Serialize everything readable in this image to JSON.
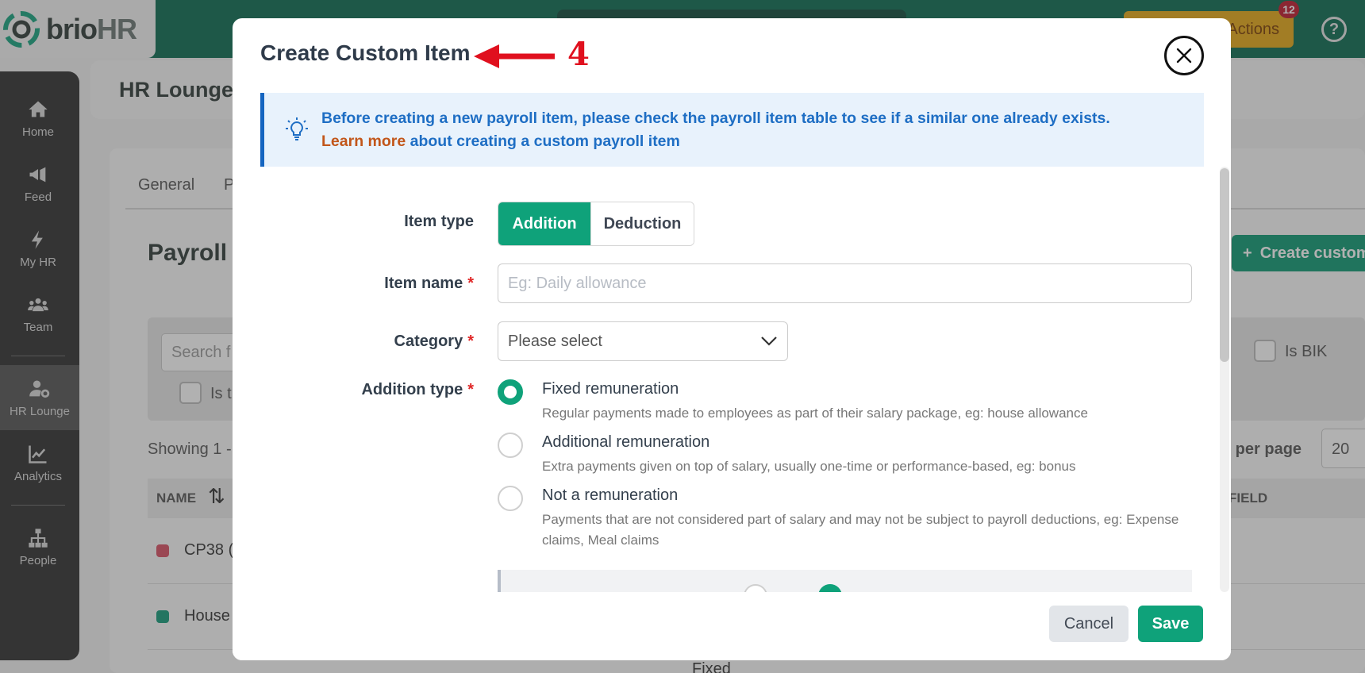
{
  "app": {
    "logo_main": "brio",
    "logo_suffix": "HR"
  },
  "topbar": {
    "actions_label": "Actions",
    "notification_count": "12",
    "help_label": "?"
  },
  "sidebar": {
    "items": [
      {
        "label": "Home",
        "icon": "home-icon"
      },
      {
        "label": "Feed",
        "icon": "megaphone-icon"
      },
      {
        "label": "My HR",
        "icon": "bolt-icon"
      },
      {
        "label": "Team",
        "icon": "team-icon"
      },
      {
        "label": "HR Lounge",
        "icon": "user-gear-icon",
        "active": true
      },
      {
        "label": "Analytics",
        "icon": "chart-line-icon"
      },
      {
        "label": "People",
        "icon": "org-chart-icon"
      }
    ]
  },
  "background": {
    "page_title": "HR Lounge",
    "tabs": [
      "General",
      "P"
    ],
    "section_title": "Payroll I",
    "create_button": "Create custom",
    "search_placeholder": "Search f",
    "is_bik_label": "Is BIK",
    "is_t_label": "Is t",
    "showing_text": "Showing 1 -",
    "per_page_label": "s per page",
    "per_page_value": "20",
    "table_headers": {
      "name": "NAME",
      "field": "FIELD"
    },
    "rows": [
      {
        "name": "CP38 (",
        "color": "#d94f63"
      },
      {
        "name": "House",
        "color": "#159c7a"
      }
    ],
    "fixed_text": "Fixed"
  },
  "modal": {
    "title": "Create Custom Item",
    "annotation_number": "4",
    "info": {
      "text_before": "Before creating a new payroll item, please check the payroll item table to see if a similar one already exists.",
      "link_text": "Learn more",
      "text_after": "about creating a custom payroll item"
    },
    "item_type": {
      "label": "Item type",
      "options": [
        "Addition",
        "Deduction"
      ],
      "selected": "Addition"
    },
    "item_name": {
      "label": "Item name",
      "placeholder": "Eg: Daily allowance",
      "value": ""
    },
    "category": {
      "label": "Category",
      "value": "Please select"
    },
    "addition_type": {
      "label": "Addition type",
      "options": [
        {
          "title": "Fixed remuneration",
          "description": "Regular payments made to employees as part of their salary package, eg: house allowance",
          "selected": true
        },
        {
          "title": "Additional remuneration",
          "description": "Extra payments given on top of salary, usually one-time or performance-based, eg: bonus",
          "selected": false
        },
        {
          "title": "Not a remuneration",
          "description": "Payments that are not considered part of salary and may not be subject to payroll deductions, eg: Expense claims, Meal claims",
          "selected": false
        }
      ]
    },
    "required_marker": "*",
    "buttons": {
      "cancel": "Cancel",
      "save": "Save"
    }
  },
  "colors": {
    "brand_green": "#0fa27a",
    "topbar": "#0b6b50",
    "info_blue": "#1e6ec4",
    "link_orange": "#c2561a",
    "required_red": "#e02626",
    "annotation_red": "#e0101e"
  }
}
